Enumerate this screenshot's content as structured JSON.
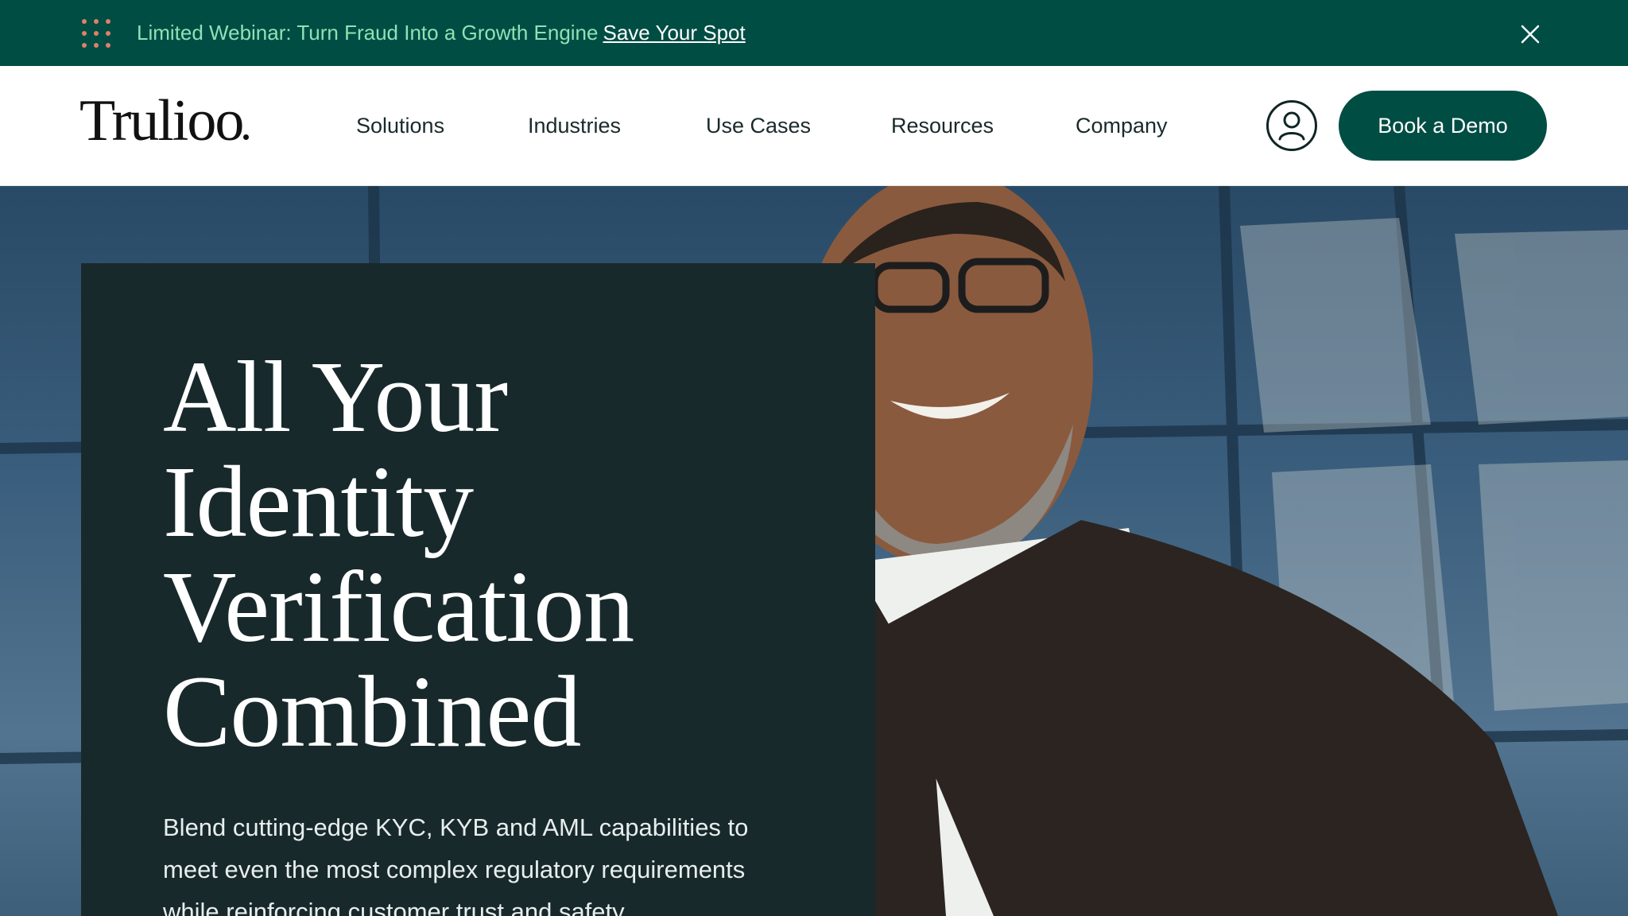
{
  "announcement": {
    "text": "Limited Webinar: Turn Fraud Into a Growth Engine",
    "link": "Save Your Spot",
    "icon": "grid-dots-icon",
    "close_icon": "close-icon"
  },
  "header": {
    "logo": "Trulioo",
    "nav": [
      "Solutions",
      "Industries",
      "Use Cases",
      "Resources",
      "Company"
    ],
    "account_icon": "user-icon",
    "cta": "Book a Demo"
  },
  "hero": {
    "title_lines": [
      "All Your",
      "Identity",
      "Verification",
      "Combined"
    ],
    "subtitle": "Blend cutting-edge KYC, KYB and AML capabilities to meet even the most complex regulatory requirements while reinforcing customer trust and safety."
  },
  "colors": {
    "brand_green": "#004d44",
    "announce_text": "#8fe2b4",
    "panel": "#18292c",
    "dots": "#e0806b"
  }
}
